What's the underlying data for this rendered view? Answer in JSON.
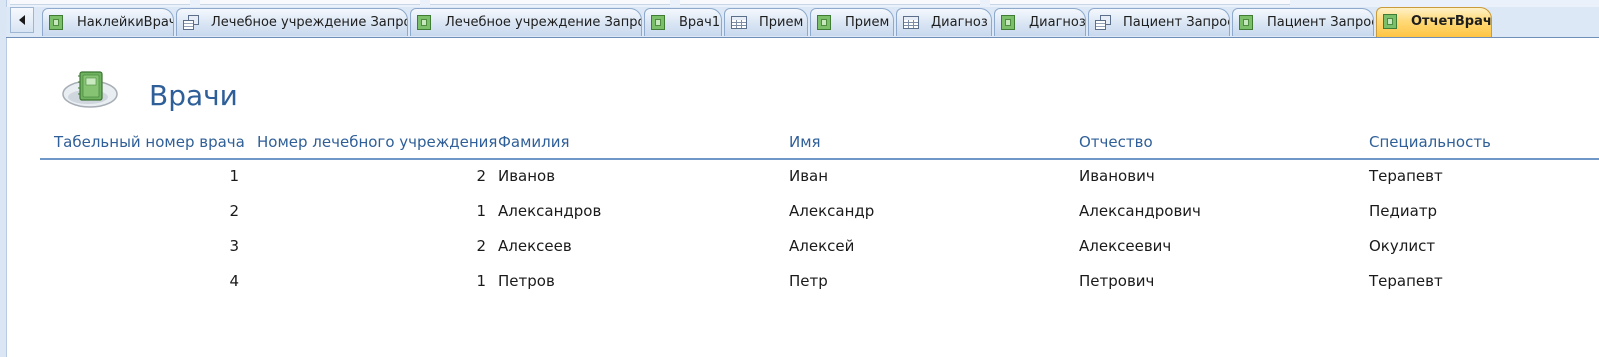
{
  "tabs": [
    {
      "label": "НаклейкиВрач",
      "icon": "form-icon",
      "active": false
    },
    {
      "label": "Лечебное учреждение Запрос",
      "icon": "query-icon",
      "active": false
    },
    {
      "label": "Лечебное учреждение Запрос",
      "icon": "form-icon",
      "active": false
    },
    {
      "label": "Врач1",
      "icon": "form-icon",
      "active": false
    },
    {
      "label": "Прием",
      "icon": "table-icon",
      "active": false
    },
    {
      "label": "Прием",
      "icon": "form-icon",
      "active": false
    },
    {
      "label": "Диагноз",
      "icon": "table-icon",
      "active": false
    },
    {
      "label": "Диагноз",
      "icon": "form-icon",
      "active": false
    },
    {
      "label": "Пациент Запрос",
      "icon": "query-icon",
      "active": false
    },
    {
      "label": "Пациент Запрос",
      "icon": "form-icon",
      "active": false
    },
    {
      "label": "ОтчетВрач",
      "icon": "form-icon",
      "active": true
    }
  ],
  "report": {
    "title": "Врачи",
    "columns": [
      "Табельный номер врача",
      "Номер лечебного учреждения",
      "Фамилия",
      "Имя",
      "Отчество",
      "Специальность"
    ],
    "rows": [
      {
        "id": "1",
        "inst": "2",
        "last": "Иванов",
        "first": "Иван",
        "middle": "Иванович",
        "spec": "Терапевт"
      },
      {
        "id": "2",
        "inst": "1",
        "last": "Александров",
        "first": "Александр",
        "middle": "Александрович",
        "spec": "Педиатр"
      },
      {
        "id": "3",
        "inst": "2",
        "last": "Алексеев",
        "first": "Алексей",
        "middle": "Алексеевич",
        "spec": "Окулист"
      },
      {
        "id": "4",
        "inst": "1",
        "last": "Петров",
        "first": "Петр",
        "middle": "Петрович",
        "spec": "Терапевт"
      }
    ]
  },
  "colors": {
    "accent": "#2f5f98",
    "active_tab": "#ffc543",
    "tab_bar": "#dce8f6"
  }
}
